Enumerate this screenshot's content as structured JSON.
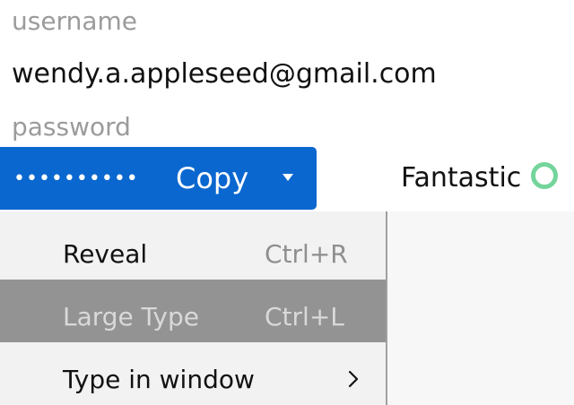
{
  "fields": {
    "username_label": "username",
    "username_value": "wendy.a.appleseed@gmail.com",
    "password_label": "password"
  },
  "password_bar": {
    "masked_value": "••••••••••",
    "copy_label": "Copy",
    "dropdown_icon": "caret-down-icon"
  },
  "strength": {
    "label": "Fantastic",
    "indicator_color": "#74d59c",
    "indicator_icon": "strength-circle-icon"
  },
  "menu": {
    "items": [
      {
        "label": "Reveal",
        "shortcut": "Ctrl+R",
        "highlighted": false
      },
      {
        "label": "Large Type",
        "shortcut": "Ctrl+L",
        "highlighted": true
      },
      {
        "label": "Type in window",
        "shortcut": "",
        "highlighted": false,
        "submenu_icon": "chevron-right-icon"
      }
    ]
  },
  "colors": {
    "accent": "#0a67cf",
    "menu_background": "#f2f2f2",
    "menu_highlight": "#939393",
    "strength": "#74d59c"
  }
}
